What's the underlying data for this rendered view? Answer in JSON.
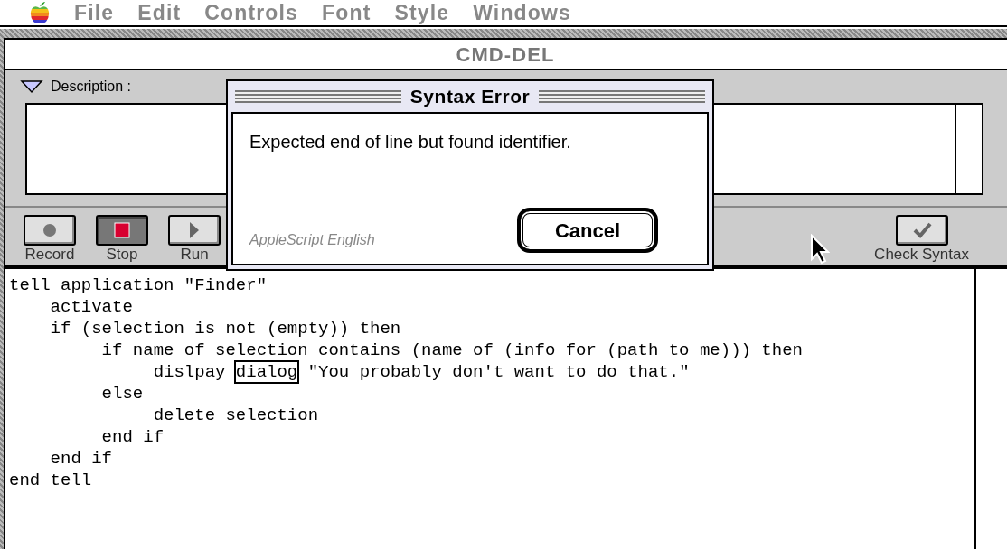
{
  "menu_bar": {
    "items": [
      {
        "label": "File",
        "disabled": true
      },
      {
        "label": "Edit",
        "disabled": true
      },
      {
        "label": "Controls",
        "disabled": true
      },
      {
        "label": "Font",
        "disabled": true
      },
      {
        "label": "Style",
        "disabled": true
      },
      {
        "label": "Windows",
        "disabled": true
      }
    ]
  },
  "window": {
    "title": "CMD-DEL"
  },
  "description": {
    "label": "Description :",
    "expanded": true
  },
  "toolbar": {
    "buttons": [
      {
        "label": "Record",
        "kind": "record",
        "pressed": false
      },
      {
        "label": "Stop",
        "kind": "stop",
        "pressed": true
      },
      {
        "label": "Run",
        "kind": "run",
        "pressed": false
      }
    ],
    "check_button": {
      "label": "Check Syntax",
      "kind": "check",
      "pressed": false
    }
  },
  "script_lines": [
    {
      "kind": "plain",
      "text": "tell application \"Finder\""
    },
    {
      "kind": "plain",
      "text": "    activate"
    },
    {
      "kind": "plain",
      "text": "    if (selection is not (empty)) then"
    },
    {
      "kind": "plain",
      "text": "         if name of selection contains (name of (info for (path to me))) then"
    },
    {
      "kind": "error",
      "before": "              dislpay ",
      "error": "dialog",
      "after": " \"You probably don't want to do that.\""
    },
    {
      "kind": "plain",
      "text": "         else"
    },
    {
      "kind": "plain",
      "text": "              delete selection"
    },
    {
      "kind": "plain",
      "text": "         end if"
    },
    {
      "kind": "plain",
      "text": "    end if"
    },
    {
      "kind": "plain",
      "text": "end tell"
    }
  ],
  "dialog": {
    "title": "Syntax Error",
    "message": "Expected end of line but found identifier.",
    "language": "AppleScript English",
    "button": "Cancel"
  }
}
